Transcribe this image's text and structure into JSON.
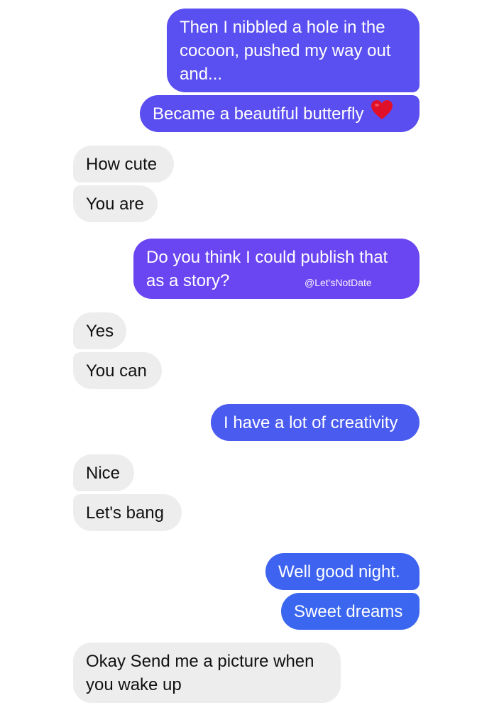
{
  "colors": {
    "outgoing_top": "#5b4ef0",
    "outgoing_mid": "#6a45f2",
    "outgoing_bottom": "#3a66f0",
    "incoming": "#ededed",
    "heart": "#e0102a"
  },
  "messages": [
    {
      "side": "outgoing",
      "text": "Then I nibbled a hole in the cocoon, pushed my way out and..."
    },
    {
      "side": "outgoing",
      "text": "Became a beautiful butterfly",
      "icon": "heart-icon"
    },
    {
      "side": "incoming",
      "text": "How cute"
    },
    {
      "side": "incoming",
      "text": "You are"
    },
    {
      "side": "outgoing",
      "text": "Do you think I could publish that as a story?"
    },
    {
      "side": "incoming",
      "text": "Yes"
    },
    {
      "side": "incoming",
      "text": "You can"
    },
    {
      "side": "outgoing",
      "text": "I have a lot of creativity"
    },
    {
      "side": "incoming",
      "text": "Nice"
    },
    {
      "side": "incoming",
      "text": "Let's bang"
    },
    {
      "side": "outgoing",
      "text": "Well good night."
    },
    {
      "side": "outgoing",
      "text": "Sweet dreams"
    },
    {
      "side": "incoming",
      "text": "Okay Send me a picture when you wake up"
    }
  ],
  "watermark": "@Let'sNotDate"
}
